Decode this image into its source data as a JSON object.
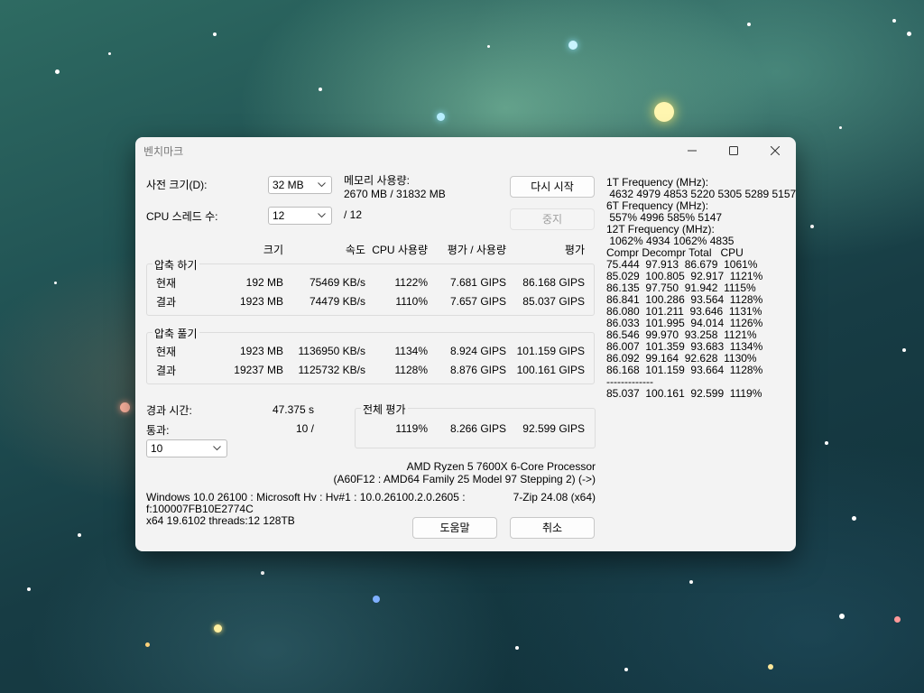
{
  "window": {
    "title": "벤치마크",
    "close_icon": "close-icon",
    "min_icon": "minimize-icon",
    "max_icon": "maximize-icon"
  },
  "settings": {
    "dict_label": "사전 크기(D):",
    "dict_value": "32 MB",
    "threads_label": "CPU 스레드 수:",
    "threads_value": "12",
    "threads_total": "/ 12",
    "memory_label": "메모리 사용량:",
    "memory_value": "2670 MB / 31832 MB"
  },
  "buttons": {
    "restart": "다시 시작",
    "stop": "중지",
    "help": "도움말",
    "cancel": "취소"
  },
  "columns": {
    "size": "크기",
    "speed": "속도",
    "cpu_usage": "CPU 사용량",
    "rating_per_usage": "평가 / 사용량",
    "rating": "평가"
  },
  "compress": {
    "label": "압축 하기",
    "rows": [
      {
        "name": "현재",
        "size": "192 MB",
        "speed": "75469 KB/s",
        "usage": "1122%",
        "rpu": "7.681 GIPS",
        "rating": "86.168 GIPS"
      },
      {
        "name": "결과",
        "size": "1923 MB",
        "speed": "74479 KB/s",
        "usage": "1110%",
        "rpu": "7.657 GIPS",
        "rating": "85.037 GIPS"
      }
    ]
  },
  "decompress": {
    "label": "압축 풀기",
    "rows": [
      {
        "name": "현재",
        "size": "1923 MB",
        "speed": "1136950 KB/s",
        "usage": "1134%",
        "rpu": "8.924 GIPS",
        "rating": "101.159 GIPS"
      },
      {
        "name": "결과",
        "size": "19237 MB",
        "speed": "1125732 KB/s",
        "usage": "1128%",
        "rpu": "8.876 GIPS",
        "rating": "100.161 GIPS"
      }
    ]
  },
  "summary": {
    "elapsed_label": "경과 시간:",
    "elapsed_value": "47.375 s",
    "passes_label": "통과:",
    "passes_value": "10 /",
    "passes_combo": "10",
    "total_label": "전체 평가",
    "total_usage": "1119%",
    "total_rpu": "8.266 GIPS",
    "total_rating": "92.599 GIPS"
  },
  "system": {
    "cpu_name": "AMD Ryzen 5 7600X 6-Core Processor",
    "cpu_detail": "(A60F12 : AMD64 Family 25 Model 97 Stepping 2) (->)",
    "os_line1": "Windows 10.0 26100 : Microsoft Hv : Hv#1 : 10.0.26100.2.0.2605 :",
    "os_line2": "f:100007FB10E2774C",
    "os_line3": "x64 19.6102 threads:12 128TB",
    "version": "7-Zip 24.08 (x64)"
  },
  "log": [
    "1T Frequency (MHz):",
    " 4632 4979 4853 5220 5305 5289 5157",
    "6T Frequency (MHz):",
    " 557% 4996 585% 5147",
    "12T Frequency (MHz):",
    " 1062% 4934 1062% 4835",
    "Compr Decompr Total   CPU",
    "75.444  97.913  86.679  1061%",
    "85.029  100.805  92.917  1121%",
    "86.135  97.750  91.942  1115%",
    "86.841  100.286  93.564  1128%",
    "86.080  101.211  93.646  1131%",
    "86.033  101.995  94.014  1126%",
    "86.546  99.970  93.258  1121%",
    "86.007  101.359  93.683  1134%",
    "86.092  99.164  92.628  1130%",
    "86.168  101.159  93.664  1128%",
    "-------------",
    "85.037  100.161  92.599  1119%"
  ]
}
